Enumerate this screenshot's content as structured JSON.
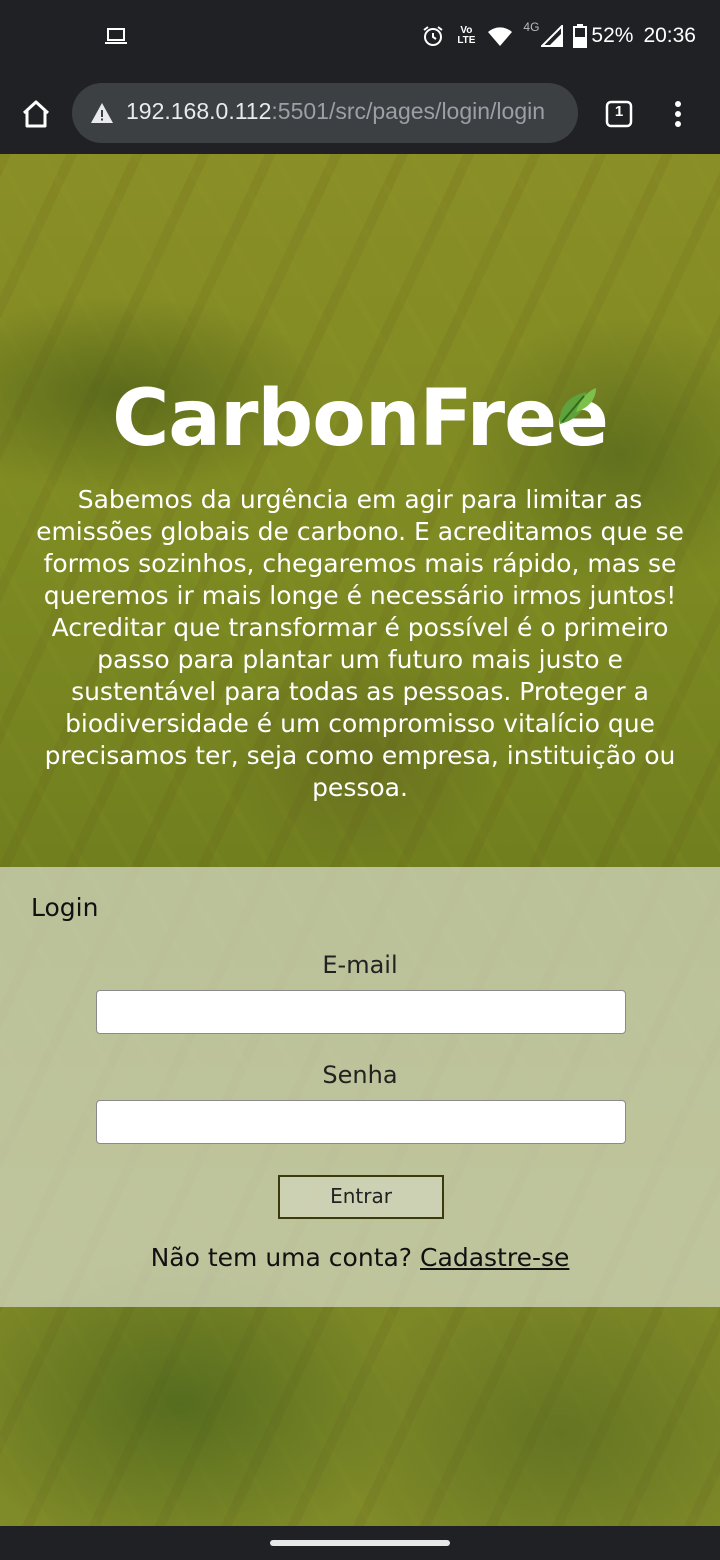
{
  "status_bar": {
    "battery": "52%",
    "time": "20:36",
    "network_label": "4G",
    "volte_label": "Vo LTE"
  },
  "browser": {
    "url_host": "192.168.0.112",
    "url_path": ":5501/src/pages/login/login",
    "tab_count": "1"
  },
  "hero": {
    "logo_text": "CarbonFree",
    "intro_text": "Sabemos da urgência em agir para limitar as emissões globais de carbono. E acreditamos que se formos sozinhos, chegaremos mais rápido, mas se queremos ir mais longe é necessário irmos juntos! Acreditar que transformar é possível é o primeiro passo para plantar um futuro mais justo e sustentável para todas as pessoas. Proteger a biodiversidade é um compromisso vitalício que precisamos ter, seja como empresa, instituição ou pessoa."
  },
  "login": {
    "title": "Login",
    "email_label": "E-mail",
    "email_value": "",
    "password_label": "Senha",
    "password_value": "",
    "submit_label": "Entrar",
    "signup_prompt": "Não tem uma conta?",
    "signup_link": "Cadastre-se"
  }
}
